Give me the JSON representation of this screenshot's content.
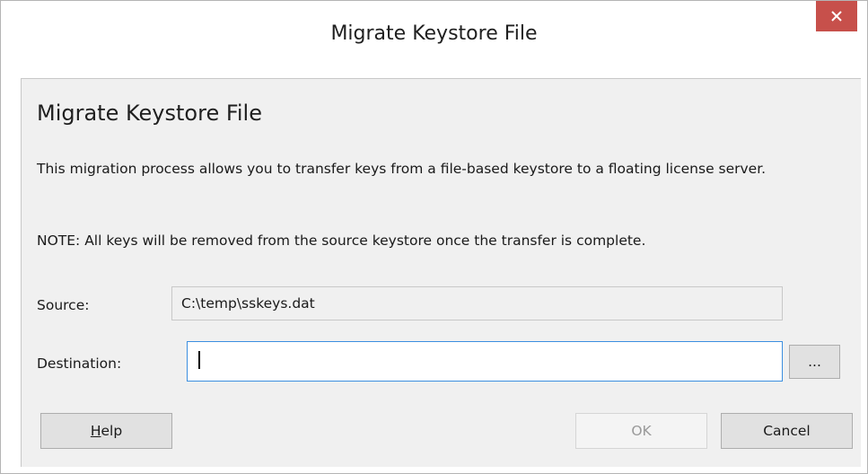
{
  "window": {
    "title": "Migrate Keystore File",
    "close_icon": "close-icon"
  },
  "content": {
    "heading": "Migrate Keystore File",
    "description": "This migration process allows you to transfer keys from a file-based keystore to a floating license server.",
    "note": "NOTE: All keys will be removed from the source keystore once the transfer is complete."
  },
  "form": {
    "source_label": "Source:",
    "source_value": "C:\\temp\\sskeys.dat",
    "destination_label": "Destination:",
    "destination_value": "",
    "browse_label": "..."
  },
  "buttons": {
    "help_accel": "H",
    "help_rest": "elp",
    "ok_label": "OK",
    "cancel_label": "Cancel"
  },
  "colors": {
    "close_button_bg": "#c7504b",
    "focus_border": "#3c8fe0"
  }
}
